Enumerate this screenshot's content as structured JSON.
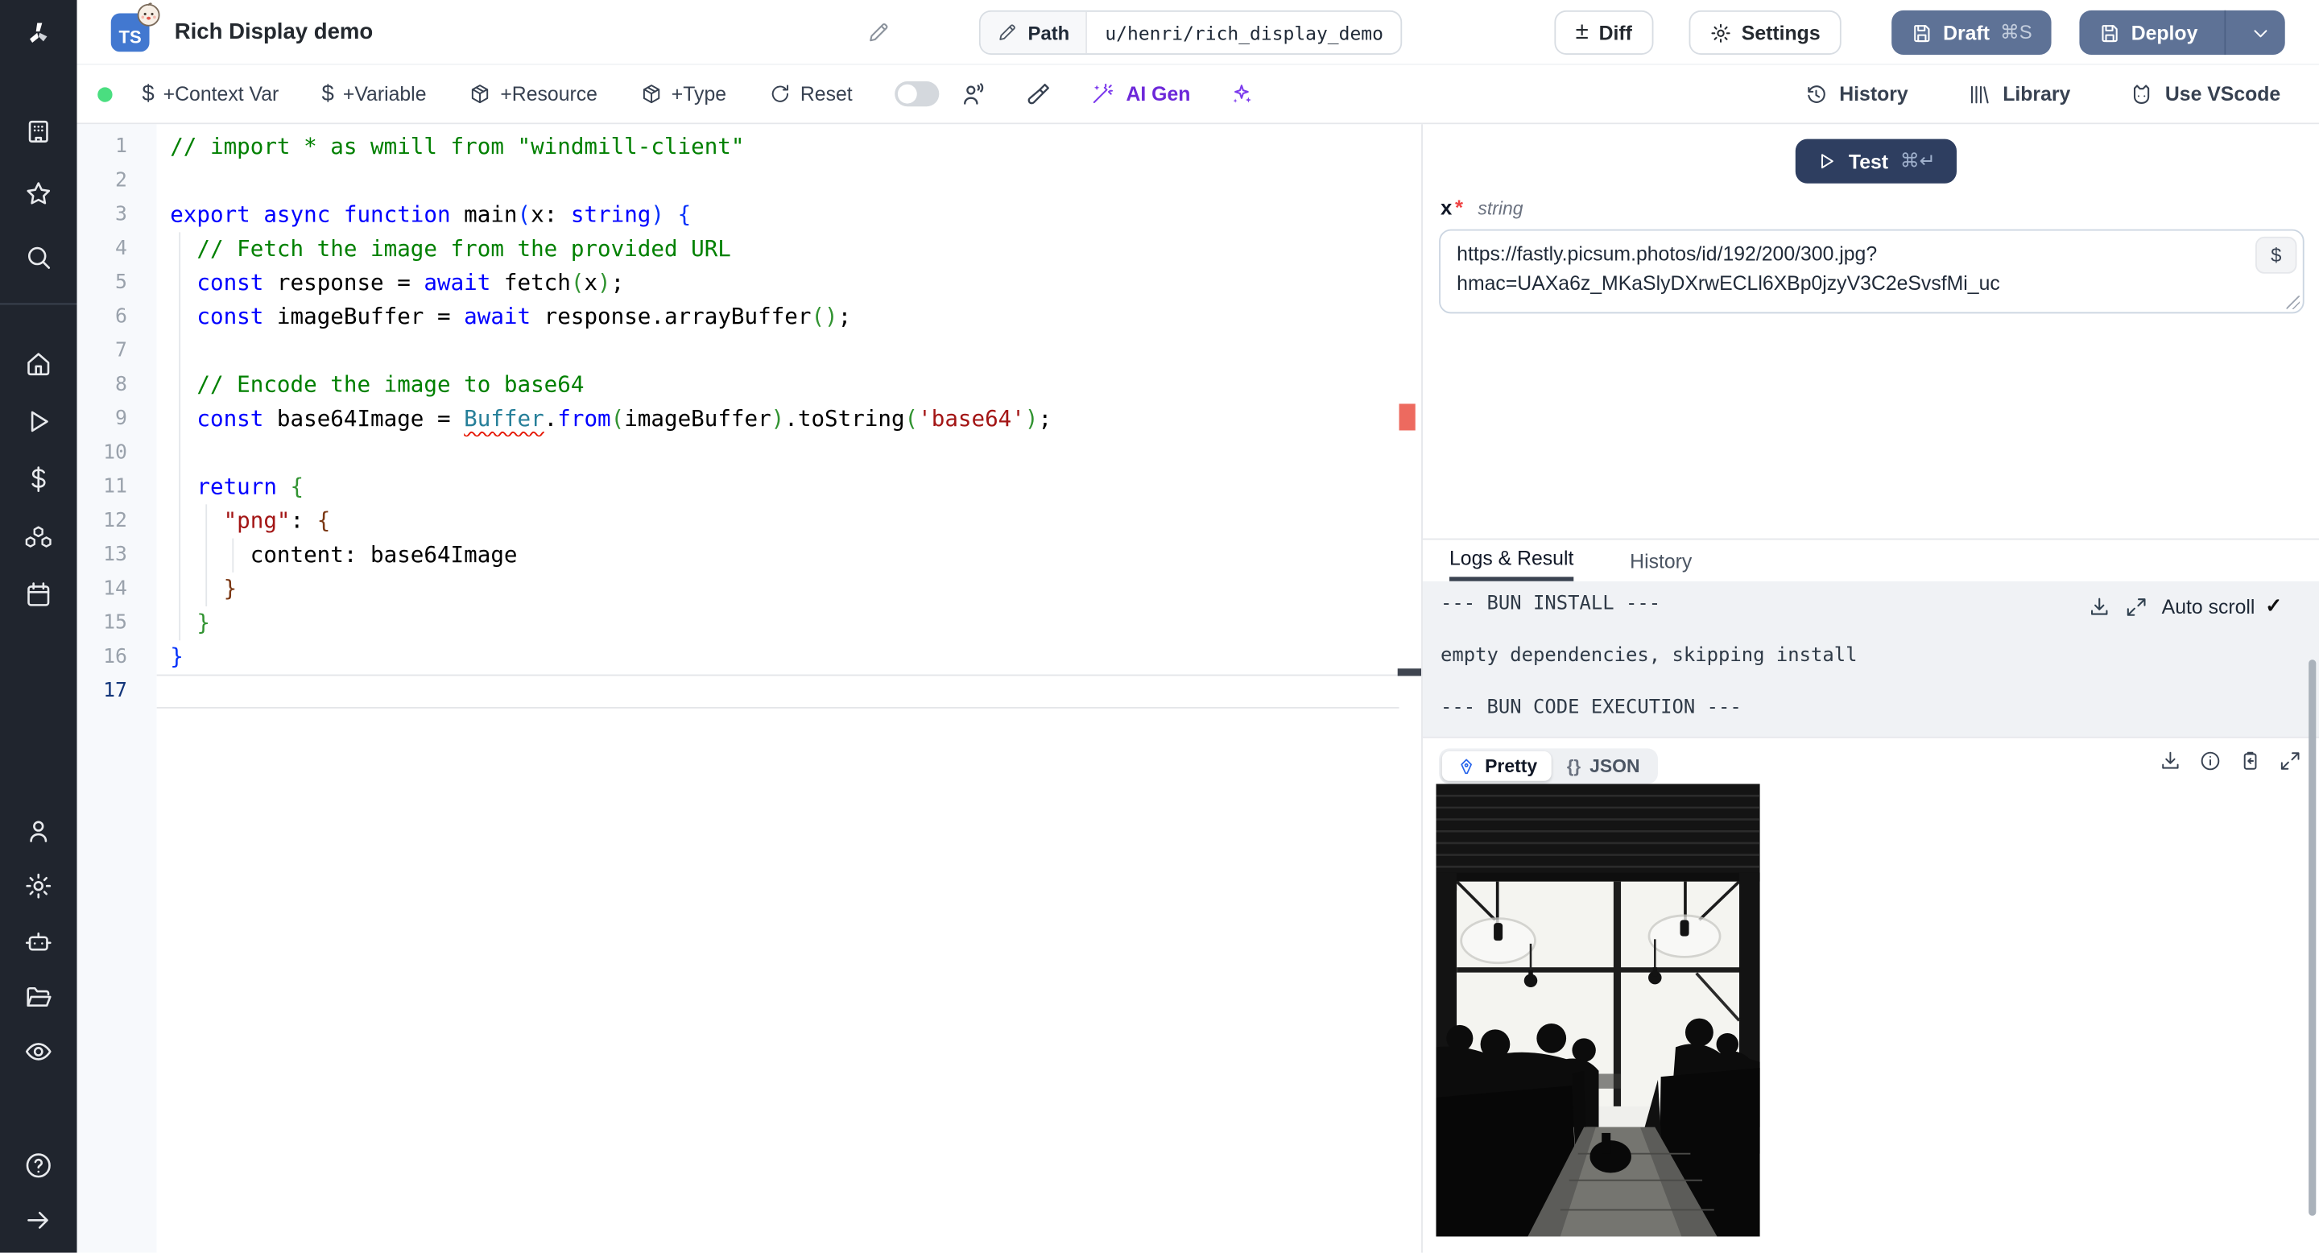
{
  "header": {
    "language_badge": "TS",
    "title": "Rich Display demo",
    "path": {
      "label": "Path",
      "value": "u/henri/rich_display_demo"
    },
    "buttons": {
      "diff": "Diff",
      "settings": "Settings",
      "draft": "Draft",
      "draft_shortcut": "⌘S",
      "deploy": "Deploy"
    }
  },
  "toolbar": {
    "status_color": "#4ade80",
    "context_var": "+Context Var",
    "variable": "+Variable",
    "resource": "+Resource",
    "type": "+Type",
    "reset": "Reset",
    "ai_gen": "AI Gen",
    "history": "History",
    "library": "Library",
    "vscode": "Use VScode"
  },
  "editor": {
    "lines": [
      {
        "n": 1,
        "segs": [
          {
            "t": "// import * as wmill from \"windmill-client\"",
            "c": "cmt"
          }
        ]
      },
      {
        "n": 2,
        "segs": []
      },
      {
        "n": 3,
        "segs": [
          {
            "t": "export ",
            "c": "kw"
          },
          {
            "t": "async ",
            "c": "kw"
          },
          {
            "t": "function ",
            "c": "kw"
          },
          {
            "t": "main",
            "c": "pl"
          },
          {
            "t": "(",
            "c": "b1"
          },
          {
            "t": "x: ",
            "c": "pl"
          },
          {
            "t": "string",
            "c": "kw"
          },
          {
            "t": ")",
            "c": "b1"
          },
          {
            "t": " ",
            "c": "pl"
          },
          {
            "t": "{",
            "c": "b1"
          }
        ]
      },
      {
        "n": 4,
        "segs": [
          {
            "t": "  // Fetch the image from the provided URL",
            "c": "cmt"
          }
        ]
      },
      {
        "n": 5,
        "segs": [
          {
            "t": "  ",
            "c": "pl"
          },
          {
            "t": "const",
            "c": "kw"
          },
          {
            "t": " response = ",
            "c": "pl"
          },
          {
            "t": "await",
            "c": "kw"
          },
          {
            "t": " fetch",
            "c": "pl"
          },
          {
            "t": "(",
            "c": "b2"
          },
          {
            "t": "x",
            "c": "pl"
          },
          {
            "t": ")",
            "c": "b2"
          },
          {
            "t": ";",
            "c": "pl"
          }
        ]
      },
      {
        "n": 6,
        "segs": [
          {
            "t": "  ",
            "c": "pl"
          },
          {
            "t": "const",
            "c": "kw"
          },
          {
            "t": " imageBuffer = ",
            "c": "pl"
          },
          {
            "t": "await",
            "c": "kw"
          },
          {
            "t": " response.arrayBuffer",
            "c": "pl"
          },
          {
            "t": "(",
            "c": "b2"
          },
          {
            "t": ")",
            "c": "b2"
          },
          {
            "t": ";",
            "c": "pl"
          }
        ]
      },
      {
        "n": 7,
        "segs": []
      },
      {
        "n": 8,
        "segs": [
          {
            "t": "  // Encode the image to base64",
            "c": "cmt"
          }
        ]
      },
      {
        "n": 9,
        "segs": [
          {
            "t": "  ",
            "c": "pl"
          },
          {
            "t": "const",
            "c": "kw"
          },
          {
            "t": " base64Image = ",
            "c": "pl"
          },
          {
            "t": "Buffer",
            "c": "cls",
            "u": true
          },
          {
            "t": ".",
            "c": "pl"
          },
          {
            "t": "from",
            "c": "kw"
          },
          {
            "t": "(",
            "c": "b2"
          },
          {
            "t": "imageBuffer",
            "c": "pl"
          },
          {
            "t": ")",
            "c": "b2"
          },
          {
            "t": ".toString",
            "c": "pl"
          },
          {
            "t": "(",
            "c": "b2"
          },
          {
            "t": "'base64'",
            "c": "str"
          },
          {
            "t": ")",
            "c": "b2"
          },
          {
            "t": ";",
            "c": "pl"
          }
        ]
      },
      {
        "n": 10,
        "segs": []
      },
      {
        "n": 11,
        "segs": [
          {
            "t": "  ",
            "c": "pl"
          },
          {
            "t": "return",
            "c": "kw"
          },
          {
            "t": " ",
            "c": "pl"
          },
          {
            "t": "{",
            "c": "b2"
          }
        ]
      },
      {
        "n": 12,
        "segs": [
          {
            "t": "    ",
            "c": "pl"
          },
          {
            "t": "\"png\"",
            "c": "str"
          },
          {
            "t": ": ",
            "c": "pl"
          },
          {
            "t": "{",
            "c": "b3"
          }
        ]
      },
      {
        "n": 13,
        "segs": [
          {
            "t": "      content: base64Image",
            "c": "pl"
          }
        ]
      },
      {
        "n": 14,
        "segs": [
          {
            "t": "    ",
            "c": "pl"
          },
          {
            "t": "}",
            "c": "b3"
          }
        ]
      },
      {
        "n": 15,
        "segs": [
          {
            "t": "  ",
            "c": "pl"
          },
          {
            "t": "}",
            "c": "b2"
          }
        ]
      },
      {
        "n": 16,
        "segs": [
          {
            "t": "}",
            "c": "b1"
          }
        ]
      },
      {
        "n": 17,
        "segs": [],
        "active": true
      }
    ]
  },
  "right_panel": {
    "test": {
      "label": "Test",
      "shortcut": "⌘↵"
    },
    "arg": {
      "name": "x",
      "required_mark": "*",
      "type": "string",
      "value": "https://fastly.picsum.photos/id/192/200/300.jpg?hmac=UAXa6z_MKaSlyDXrwECLl6XBp0jzyV3C2eSvsfMi_uc",
      "var_button": "$"
    },
    "tabs": {
      "logs": "Logs & Result",
      "history": "History"
    },
    "logs": {
      "lines": [
        "--- BUN INSTALL ---",
        "",
        "empty dependencies, skipping install",
        "",
        "--- BUN CODE EXECUTION ---"
      ],
      "auto_scroll": "Auto scroll",
      "check": "✓"
    },
    "result": {
      "pretty": "Pretty",
      "json_braces": "{}",
      "json": "JSON"
    }
  },
  "icons": {
    "sidebar": [
      "windmill-logo",
      "building",
      "star",
      "search",
      "home",
      "play",
      "dollar",
      "cubes",
      "calendar",
      "user",
      "gear",
      "robot",
      "folder-open",
      "eye",
      "help-circle",
      "arrow-right"
    ],
    "colors": {
      "accent_purple": "#6d28d9",
      "slate_button": "#5e7296",
      "test_button": "#2e3e60",
      "status_green": "#4ade80",
      "error_marker": "#ed6a5f"
    }
  }
}
